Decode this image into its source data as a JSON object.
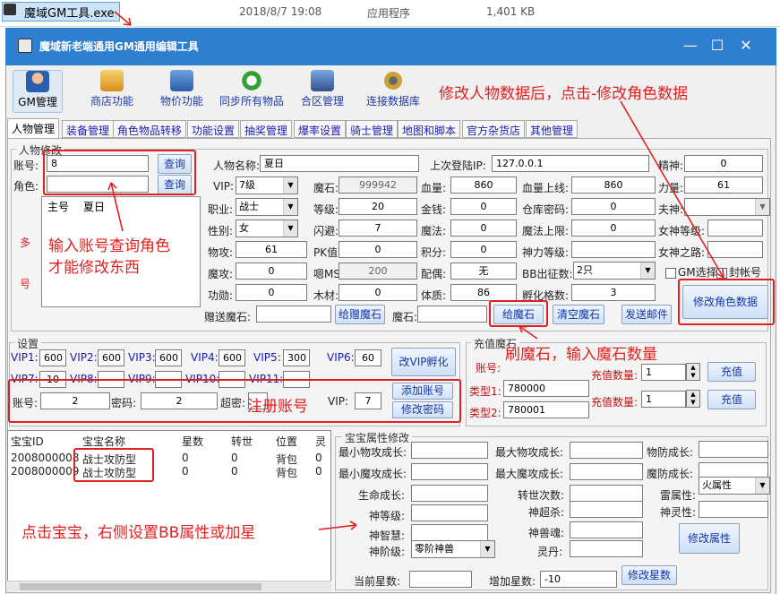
{
  "file_row": {
    "name": "魔域GM工具.exe",
    "date": "2018/8/7 19:08",
    "type": "应用程序",
    "size": "1,401 KB"
  },
  "window": {
    "title": "魔域新老端通用GM通用编辑工具",
    "minimize": "—",
    "maximize": "☐",
    "close": "✕"
  },
  "toolbar": [
    {
      "label": "GM管理",
      "icon": "gm-person-icon"
    },
    {
      "label": "商店功能",
      "icon": "shop-icon"
    },
    {
      "label": "物价功能",
      "icon": "price-computer-icon"
    },
    {
      "label": "同步所有物品",
      "icon": "sync-icon"
    },
    {
      "label": "合区管理",
      "icon": "merge-server-icon"
    },
    {
      "label": "连接数据库",
      "icon": "database-icon"
    }
  ],
  "tabs": [
    "人物管理",
    "装备管理",
    "角色物品转移",
    "功能设置",
    "抽奖管理",
    "爆率设置",
    "骑士管理",
    "地图和脚本",
    "官方杂货店",
    "其他管理"
  ],
  "char_edit": {
    "legend": "人物修改",
    "account_label": "账号:",
    "account_value": "8",
    "query1": "查询",
    "role_label": "角色:",
    "role_value": "",
    "query2": "查询",
    "list_headers": [
      "主号",
      "夏日"
    ],
    "multi_label": [
      "多",
      "号"
    ],
    "name_label": "人物名称:",
    "name_value": "夏日",
    "last_ip_label": "上次登陆IP:",
    "last_ip_value": "127.0.0.1",
    "spirit_label": "精神:",
    "spirit_value": "0",
    "vip_label": "VIP:",
    "vip_value": "7级",
    "mstone_label": "魔石:",
    "mstone_value": "999942",
    "hp_label": "血量:",
    "hp_value": "860",
    "hpmax_label": "血量上线:",
    "hpmax_value": "860",
    "power_label": "力量:",
    "power_value": "61",
    "job_label": "职业:",
    "job_value": "战士",
    "level_label": "等级:",
    "level_value": "20",
    "gold_label": "金钱:",
    "gold_value": "0",
    "warehouse_label": "仓库密码:",
    "warehouse_value": "0",
    "spouse_label": "夫神:",
    "spouse_value": "",
    "sex_label": "性别:",
    "sex_value": "女",
    "dodge_label": "闪避:",
    "dodge_value": "7",
    "mp_label": "魔法:",
    "mp_value": "0",
    "mpmax_label": "魔法上限:",
    "mpmax_value": "0",
    "goddess_level_label": "女神等级:",
    "goddess_level_value": "",
    "patk_label": "物攻:",
    "patk_value": "61",
    "pk_label": "PK值:",
    "pk_value": "0",
    "score_label": "积分:",
    "score_value": "0",
    "godpower_label": "神力等级:",
    "godpower_value": "",
    "goddess_road_label": "女神之路:",
    "goddess_road_value": "",
    "matk_label": "魔攻:",
    "matk_value": "0",
    "ms_label": "嗯MS:",
    "ms_value": "200",
    "spouse2_label": "配偶:",
    "spouse2_value": "无",
    "bb_label": "BB出征数:",
    "bb_value": "2只",
    "gm_select_label": "GM选择",
    "ban_label": "封帐号",
    "merit_label": "功勋:",
    "merit_value": "0",
    "wood_label": "木材:",
    "wood_value": "0",
    "constitution_label": "体质:",
    "constitution_value": "86",
    "hatch_label": "孵化格数:",
    "hatch_value": "3",
    "gift_label": "赠送魔石:",
    "gift_value": "",
    "gift_btn": "给赠魔石",
    "stone2_label": "魔石:",
    "stone2_value": "",
    "give_btn": "给魔石",
    "clear_btn": "清空魔石",
    "mail_btn": "发送邮件",
    "modify_btn": "修改角色数据"
  },
  "settings": {
    "legend": "设置",
    "vips": [
      {
        "label": "VIP1:",
        "value": "600"
      },
      {
        "label": "VIP2:",
        "value": "600"
      },
      {
        "label": "VIP3:",
        "value": "600"
      },
      {
        "label": "VIP4:",
        "value": "600"
      },
      {
        "label": "VIP5:",
        "value": "300"
      },
      {
        "label": "VIP6:",
        "value": "60"
      },
      {
        "label": "VIP7:",
        "value": "10"
      },
      {
        "label": "VIP8:",
        "value": ""
      },
      {
        "label": "VIP9:",
        "value": ""
      },
      {
        "label": "VIP10:",
        "value": ""
      },
      {
        "label": "VIP11:",
        "value": ""
      }
    ],
    "vip_hatch_btn": "改VIP孵化",
    "acc_label": "账号:",
    "acc_value": "2",
    "pwd_label": "密码:",
    "pwd_value": "2",
    "super_label": "超密:",
    "super_value": "",
    "vip_label": "VIP:",
    "vip_value": "7",
    "add_btn": "添加账号",
    "change_btn": "修改密码"
  },
  "recharge": {
    "legend": "充值魔石",
    "acc_label": "账号:",
    "type1_label": "类型1:",
    "type1_value": "780000",
    "type2_label": "类型2:",
    "type2_value": "780001",
    "qty_label": "充值数量:",
    "qty1": "1",
    "qty2": "1",
    "btn": "充值"
  },
  "pets": {
    "headers": [
      "宝宝ID",
      "宝宝名称",
      "星数",
      "转世",
      "位置",
      "灵"
    ],
    "rows": [
      [
        "2008000008",
        "战士攻防型",
        "0",
        "0",
        "背包",
        "0"
      ],
      [
        "2008000009",
        "战士攻防型",
        "0",
        "0",
        "背包",
        "0"
      ]
    ]
  },
  "pet_attr": {
    "legend": "宝宝属性修改",
    "min_patk": "最小物攻成长:",
    "max_patk": "最大物攻成长:",
    "pdef": "物防成长:",
    "min_matk": "最小魔攻成长:",
    "max_matk": "最大魔攻成长:",
    "mdef": "魔防成长:",
    "life": "生命成长:",
    "reborn": "转世次数:",
    "thunder": "雷属性:",
    "thunder_value": "火属性",
    "god_level": "神等级:",
    "god_super": "神超杀:",
    "god_spirit": "神灵性:",
    "god_wisdom": "神智慧:",
    "god_soul": "神兽魂:",
    "god_rank": "神阶级:",
    "god_rank_value": "零阶神兽",
    "elixir": "灵丹:",
    "modify_attr_btn": "修改属性",
    "cur_star": "当前星数:",
    "add_star": "增加星数:",
    "add_star_value": "-10",
    "modify_star_btn": "修改星数"
  },
  "annotations": {
    "modify_hint": "修改人物数据后，点击-修改角色数据",
    "query_hint_1": "输入账号查询角色",
    "query_hint_2": "才能修改东西",
    "stone_hint": "刷魔石，输入魔石数量",
    "register_hint": "注册账号",
    "pet_hint": "点击宝宝，右侧设置BB属性或加星"
  },
  "colors": {
    "titlebar": "#2f7fd1",
    "annotation": "#e02020",
    "link_text": "#1637a6"
  }
}
